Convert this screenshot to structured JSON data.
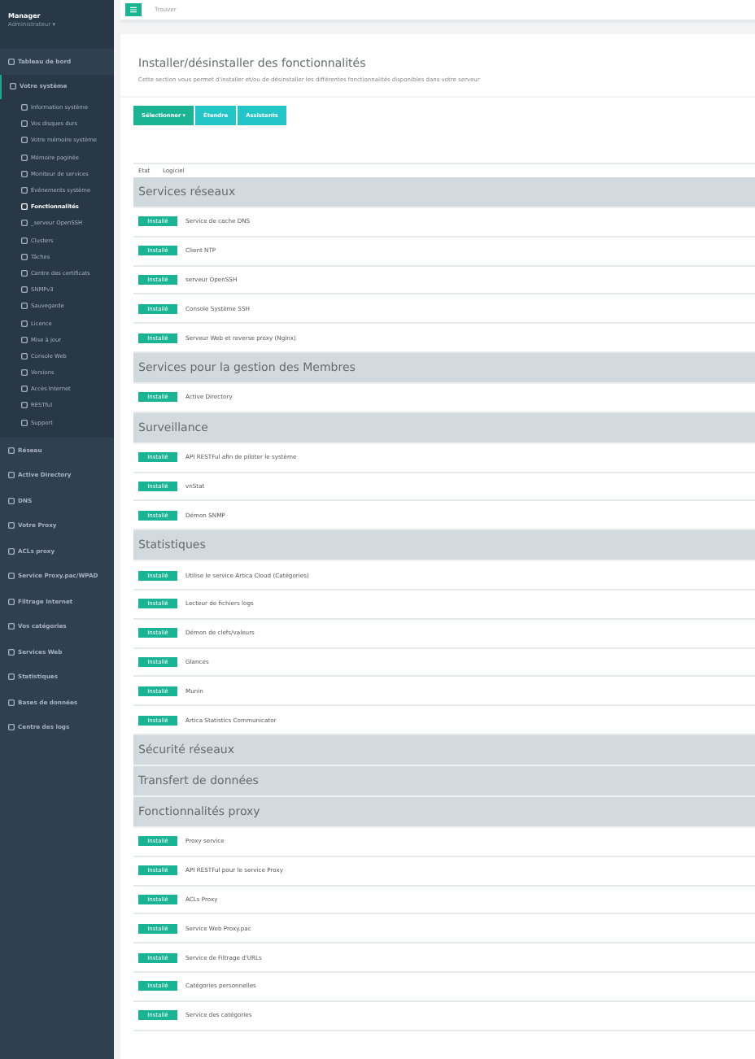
{
  "sidebar": {
    "user": {
      "name": "Manager",
      "role": "Administrateur ▾"
    },
    "items": [
      {
        "label": "Tableau de bord",
        "selected": false,
        "expanded": false
      },
      {
        "label": "Votre système",
        "selected": false,
        "expanded": true,
        "children": [
          {
            "label": "Information système",
            "selected": false
          },
          {
            "label": "Vos disques durs",
            "selected": false
          },
          {
            "label": "Votre mémoire système",
            "selected": false
          },
          {
            "label": "Mémoire paginée",
            "selected": false
          },
          {
            "label": "Moniteur de services",
            "selected": false
          },
          {
            "label": "Événements système",
            "selected": false
          },
          {
            "label": "Fonctionnalités",
            "selected": true
          },
          {
            "label": "_serveur OpenSSH",
            "selected": false
          },
          {
            "label": "Clusters",
            "selected": false
          },
          {
            "label": "Tâches",
            "selected": false
          },
          {
            "label": "Centre des certificats",
            "selected": false
          },
          {
            "label": "SNMPv3",
            "selected": false
          },
          {
            "label": "Sauvegarde",
            "selected": false
          },
          {
            "label": "Licence",
            "selected": false
          },
          {
            "label": "Mise à jour",
            "selected": false
          },
          {
            "label": "Console Web",
            "selected": false
          },
          {
            "label": "Versions",
            "selected": false
          },
          {
            "label": "Accès Internet",
            "selected": false
          },
          {
            "label": "RESTful",
            "selected": false
          },
          {
            "label": "Support",
            "selected": false
          }
        ]
      },
      {
        "label": "Réseau",
        "selected": false,
        "expanded": false
      },
      {
        "label": "Active Directory",
        "selected": false,
        "expanded": false
      },
      {
        "label": "DNS",
        "selected": false,
        "expanded": false
      },
      {
        "label": "Votre Proxy",
        "selected": false,
        "expanded": false
      },
      {
        "label": "ACLs proxy",
        "selected": false,
        "expanded": false
      },
      {
        "label": "Service Proxy.pac/WPAD",
        "selected": false,
        "expanded": false
      },
      {
        "label": "Filtrage Internet",
        "selected": false,
        "expanded": false
      },
      {
        "label": "Vos catégories",
        "selected": false,
        "expanded": false
      },
      {
        "label": "Services Web",
        "selected": false,
        "expanded": false
      },
      {
        "label": "Statistiques",
        "selected": false,
        "expanded": false
      },
      {
        "label": "Bases de données",
        "selected": false,
        "expanded": false
      },
      {
        "label": "Centre des logs",
        "selected": false,
        "expanded": false
      }
    ]
  },
  "topbar": {
    "search": {
      "placeholder": "Trouver"
    }
  },
  "page": {
    "title": "Installer/désinstaller des fonctionnalités",
    "description": "Cette section vous permet d'installer et/ou de désinstaller les différentes fonctionnalités disponibles dans votre serveur"
  },
  "toolbar": [
    {
      "label": "Sélectionner ▾",
      "kind": "primary"
    },
    {
      "label": "Étendre",
      "kind": "secondary"
    },
    {
      "label": "Assistants",
      "kind": "secondary"
    }
  ],
  "table": {
    "columns": [
      "Etat",
      "Logiciel"
    ],
    "sections": [
      {
        "title": "Services réseaux",
        "rows": [
          {
            "status": "Installé",
            "name": "Service de cache DNS"
          },
          {
            "status": "Installé",
            "name": "Client NTP"
          },
          {
            "status": "Installé",
            "name": "serveur OpenSSH"
          },
          {
            "status": "Installé",
            "name": "Console Système SSH"
          },
          {
            "status": "Installé",
            "name": "Serveur Web et reverse proxy (Nginx)"
          }
        ]
      },
      {
        "title": "Services pour la gestion des Membres",
        "rows": [
          {
            "status": "Installé",
            "name": "Active Directory"
          }
        ]
      },
      {
        "title": "Surveillance",
        "rows": [
          {
            "status": "Installé",
            "name": "API RESTFul afin de piloter le système"
          },
          {
            "status": "Installé",
            "name": "vnStat"
          },
          {
            "status": "Installé",
            "name": "Démon SNMP"
          }
        ]
      },
      {
        "title": "Statistiques",
        "rows": [
          {
            "status": "Installé",
            "name": "Utilise le service Artica Cloud (Catégories)"
          },
          {
            "status": "Installé",
            "name": "Lecteur de fichiers logs"
          },
          {
            "status": "Installé",
            "name": "Démon de clefs/valeurs"
          },
          {
            "status": "Installé",
            "name": "Glances"
          },
          {
            "status": "Installé",
            "name": "Munin"
          },
          {
            "status": "Installé",
            "name": "Artica Statistics Communicator"
          }
        ]
      },
      {
        "title": "Sécurité réseaux"
      },
      {
        "title": "Transfert de données"
      },
      {
        "title": "Fonctionnalités proxy",
        "rows": [
          {
            "status": "Installé",
            "name": "Proxy service"
          },
          {
            "status": "Installé",
            "name": "API RESTFul pour le service Proxy"
          },
          {
            "status": "Installé",
            "name": "ACLs Proxy"
          },
          {
            "status": "Installé",
            "name": "Service Web Proxy.pac"
          },
          {
            "status": "Installé",
            "name": "Service de Filtrage d'URLs"
          },
          {
            "status": "Installé",
            "name": "Catégories personnelles"
          },
          {
            "status": "Installé",
            "name": "Service des catégories"
          }
        ]
      }
    ]
  }
}
